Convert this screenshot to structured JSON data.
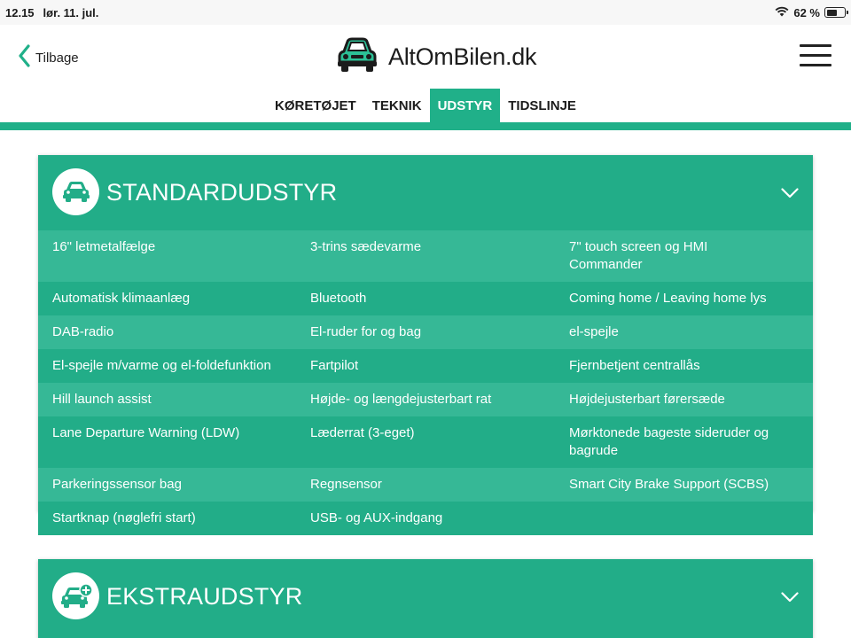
{
  "status": {
    "time": "12.15",
    "date": "lør. 11. jul.",
    "battery": "62 %",
    "battery_level": 0.62
  },
  "header": {
    "back_label": "Tilbage",
    "logo_text": "AltOmBilen.dk"
  },
  "tabs": [
    {
      "label": "KØRETØJET",
      "active": false
    },
    {
      "label": "TEKNIK",
      "active": false
    },
    {
      "label": "UDSTYR",
      "active": true
    },
    {
      "label": "TIDSLINJE",
      "active": false
    }
  ],
  "standard": {
    "title": "STANDARDUDSTYR",
    "rows": [
      [
        "16\" letmetalfælge",
        "3-trins sædevarme",
        "7\" touch screen og HMI Commander"
      ],
      [
        "Automatisk klimaanlæg",
        "Bluetooth",
        "Coming home / Leaving home lys"
      ],
      [
        "DAB-radio",
        "El-ruder for og bag",
        "el-spejle"
      ],
      [
        "El-spejle m/varme og el-foldefunktion",
        "Fartpilot",
        "Fjernbetjent centrallås"
      ],
      [
        "Hill launch assist",
        "Højde- og længdejusterbart rat",
        "Højdejusterbart førersæde"
      ],
      [
        "Lane Departure Warning (LDW)",
        "Læderrat (3-eget)",
        "Mørktonede bageste sideruder og bagrude"
      ],
      [
        "Parkeringssensor bag",
        "Regnsensor",
        "Smart City Brake Support (SCBS)"
      ],
      [
        "Startknap (nøglefri start)",
        "USB- og AUX-indgang",
        ""
      ]
    ]
  },
  "extra": {
    "title": "EKSTRAUDSTYR"
  },
  "colors": {
    "accent": "#20b089",
    "row_light": "#36b896",
    "row_dark": "#22ad88"
  }
}
